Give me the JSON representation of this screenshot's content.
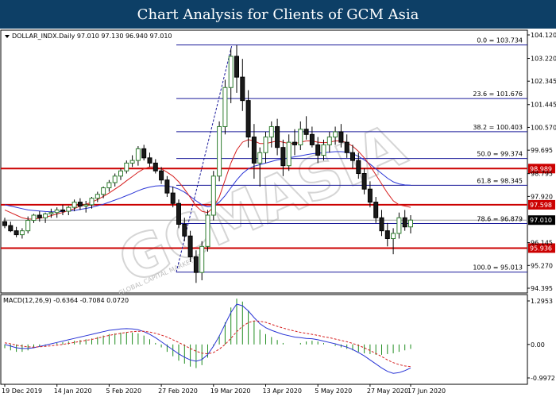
{
  "banner_title": "Chart Analysis for Clients of GCM Asia",
  "chart_data": {
    "type": "candlestick",
    "symbol_info": "DOLLAR_INDX.Daily  97.010 97.130 96.940 97.010",
    "macd_info": "MACD(12,26,9) -0.6364 -0.7084 0.0720",
    "watermark": "GCMASIA",
    "watermark_small": "GLOBAL CAPITAL MARKETS",
    "price_axis": {
      "ylim": [
        94.395,
        104.12
      ],
      "ticks": [
        "104.120",
        "103.220",
        "102.345",
        "101.445",
        "100.570",
        "99.695",
        "98.795",
        "97.920",
        "96.145",
        "95.270",
        "94.395"
      ]
    },
    "macd_axis": {
      "ylim": [
        -0.9972,
        1.2953
      ],
      "ticks": [
        "1.2953",
        "0.00",
        "-0.9972"
      ]
    },
    "x_ticks": [
      "19 Dec 2019",
      "14 Jan 2020",
      "5 Feb 2020",
      "27 Feb 2020",
      "19 Mar 2020",
      "13 Apr 2020",
      "5 May 2020",
      "27 May 2020",
      "17 Jun 2020"
    ],
    "fibonacci": [
      {
        "label": "0.0 = 103.734",
        "price": 103.734
      },
      {
        "label": "23.6 = 101.676",
        "price": 101.676
      },
      {
        "label": "38.2 = 100.403",
        "price": 100.403
      },
      {
        "label": "50.0 = 99.374",
        "price": 99.374
      },
      {
        "label": "61.8 = 98.345",
        "price": 98.345
      },
      {
        "label": "78.6 = 96.879",
        "price": 96.879
      },
      {
        "label": "100.0 = 95.013",
        "price": 95.013
      }
    ],
    "levels": [
      {
        "label": "98.989",
        "price": 98.989,
        "color": "#cc0000"
      },
      {
        "label": "97.598",
        "price": 97.598,
        "color": "#cc0000"
      },
      {
        "label": "95.936",
        "price": 95.936,
        "color": "#cc0000"
      }
    ],
    "current_price": {
      "label": "97.010",
      "price": 97.01
    },
    "candles": [
      [
        96.95,
        97.1,
        96.7,
        96.8
      ],
      [
        96.8,
        96.95,
        96.55,
        96.6
      ],
      [
        96.6,
        96.75,
        96.35,
        96.45
      ],
      [
        96.45,
        96.7,
        96.3,
        96.6
      ],
      [
        96.6,
        97.15,
        96.5,
        97.0
      ],
      [
        97.0,
        97.25,
        96.9,
        97.2
      ],
      [
        97.2,
        97.35,
        96.95,
        97.1
      ],
      [
        97.1,
        97.3,
        96.9,
        97.25
      ],
      [
        97.25,
        97.45,
        97.1,
        97.3
      ],
      [
        97.3,
        97.5,
        97.1,
        97.4
      ],
      [
        97.4,
        97.6,
        97.2,
        97.35
      ],
      [
        97.35,
        97.55,
        97.2,
        97.5
      ],
      [
        97.5,
        97.8,
        97.35,
        97.7
      ],
      [
        97.7,
        97.85,
        97.4,
        97.55
      ],
      [
        97.55,
        97.75,
        97.3,
        97.6
      ],
      [
        97.6,
        97.9,
        97.45,
        97.85
      ],
      [
        97.85,
        98.1,
        97.7,
        98.0
      ],
      [
        98.0,
        98.3,
        97.85,
        98.25
      ],
      [
        98.25,
        98.55,
        98.1,
        98.45
      ],
      [
        98.45,
        98.8,
        98.3,
        98.7
      ],
      [
        98.7,
        99.0,
        98.55,
        98.9
      ],
      [
        98.9,
        99.3,
        98.8,
        99.2
      ],
      [
        99.2,
        99.5,
        99.05,
        99.3
      ],
      [
        99.3,
        99.85,
        99.1,
        99.75
      ],
      [
        99.75,
        99.9,
        99.3,
        99.4
      ],
      [
        99.4,
        99.6,
        99.05,
        99.2
      ],
      [
        99.2,
        99.35,
        98.8,
        98.9
      ],
      [
        98.9,
        99.05,
        98.4,
        98.55
      ],
      [
        98.55,
        98.7,
        97.9,
        98.05
      ],
      [
        98.05,
        98.3,
        97.5,
        97.65
      ],
      [
        97.65,
        97.8,
        96.7,
        96.85
      ],
      [
        96.85,
        97.1,
        96.2,
        96.4
      ],
      [
        96.4,
        96.6,
        95.4,
        95.6
      ],
      [
        95.6,
        95.85,
        94.6,
        95.0
      ],
      [
        95.0,
        96.2,
        94.7,
        96.0
      ],
      [
        96.0,
        97.4,
        95.8,
        97.2
      ],
      [
        97.2,
        98.9,
        97.0,
        98.7
      ],
      [
        98.7,
        100.8,
        98.5,
        100.6
      ],
      [
        100.6,
        102.4,
        100.3,
        102.1
      ],
      [
        102.1,
        103.6,
        101.5,
        103.3
      ],
      [
        103.3,
        103.73,
        101.9,
        102.5
      ],
      [
        102.5,
        103.2,
        101.2,
        101.6
      ],
      [
        101.6,
        102.0,
        99.8,
        100.2
      ],
      [
        100.2,
        100.7,
        98.6,
        99.2
      ],
      [
        99.2,
        99.8,
        98.3,
        99.6
      ],
      [
        99.6,
        100.4,
        99.2,
        100.2
      ],
      [
        100.2,
        100.8,
        99.8,
        100.6
      ],
      [
        100.6,
        100.9,
        99.5,
        99.8
      ],
      [
        99.8,
        100.1,
        98.7,
        99.1
      ],
      [
        99.1,
        100.3,
        98.9,
        100.0
      ],
      [
        100.0,
        100.5,
        99.5,
        99.9
      ],
      [
        99.9,
        100.8,
        99.7,
        100.5
      ],
      [
        100.5,
        101.0,
        100.1,
        100.3
      ],
      [
        100.3,
        100.6,
        99.8,
        99.9
      ],
      [
        99.9,
        100.2,
        99.2,
        99.5
      ],
      [
        99.5,
        100.1,
        99.3,
        99.9
      ],
      [
        99.9,
        100.4,
        99.6,
        100.2
      ],
      [
        100.2,
        100.6,
        99.9,
        100.4
      ],
      [
        100.4,
        100.7,
        99.8,
        100.0
      ],
      [
        100.0,
        100.3,
        99.4,
        99.6
      ],
      [
        99.6,
        99.9,
        99.0,
        99.3
      ],
      [
        99.3,
        99.6,
        98.6,
        98.8
      ],
      [
        98.8,
        99.0,
        98.0,
        98.2
      ],
      [
        98.2,
        98.5,
        97.5,
        97.7
      ],
      [
        97.7,
        97.9,
        96.9,
        97.1
      ],
      [
        97.1,
        97.4,
        96.4,
        96.6
      ],
      [
        96.6,
        96.9,
        96.0,
        96.3
      ],
      [
        96.3,
        96.7,
        95.7,
        96.5
      ],
      [
        96.5,
        97.3,
        96.3,
        97.1
      ],
      [
        97.1,
        97.4,
        96.6,
        96.75
      ],
      [
        96.75,
        97.2,
        96.5,
        97.01
      ]
    ],
    "ma_red": [
      97.4,
      97.3,
      97.2,
      97.1,
      97.05,
      97.05,
      97.08,
      97.12,
      97.18,
      97.25,
      97.3,
      97.38,
      97.45,
      97.55,
      97.62,
      97.7,
      97.8,
      97.92,
      98.05,
      98.2,
      98.35,
      98.52,
      98.68,
      98.85,
      98.98,
      99.05,
      99.05,
      98.98,
      98.85,
      98.7,
      98.48,
      98.2,
      97.88,
      97.55,
      97.35,
      97.3,
      97.5,
      97.9,
      98.55,
      99.2,
      99.7,
      100.0,
      100.1,
      100.05,
      99.95,
      99.95,
      100.0,
      100.05,
      100.0,
      99.95,
      99.95,
      100.0,
      100.05,
      100.05,
      100.0,
      99.98,
      100.0,
      100.05,
      100.05,
      99.98,
      99.85,
      99.65,
      99.4,
      99.1,
      98.75,
      98.4,
      98.05,
      97.75,
      97.6,
      97.55,
      97.5
    ],
    "ma_blue": [
      97.6,
      97.55,
      97.5,
      97.45,
      97.4,
      97.38,
      97.36,
      97.34,
      97.33,
      97.33,
      97.34,
      97.36,
      97.38,
      97.42,
      97.46,
      97.5,
      97.56,
      97.62,
      97.7,
      97.78,
      97.86,
      97.95,
      98.04,
      98.14,
      98.22,
      98.28,
      98.32,
      98.33,
      98.32,
      98.28,
      98.2,
      98.08,
      97.92,
      97.75,
      97.6,
      97.52,
      97.55,
      97.7,
      97.95,
      98.25,
      98.55,
      98.8,
      98.98,
      99.08,
      99.14,
      99.2,
      99.26,
      99.32,
      99.36,
      99.4,
      99.44,
      99.48,
      99.52,
      99.56,
      99.58,
      99.6,
      99.62,
      99.64,
      99.64,
      99.62,
      99.56,
      99.46,
      99.32,
      99.16,
      98.98,
      98.8,
      98.62,
      98.48,
      98.4,
      98.36,
      98.35
    ],
    "macd_hist": [
      -0.05,
      -0.08,
      -0.1,
      -0.1,
      -0.08,
      -0.05,
      -0.03,
      -0.02,
      0.0,
      0.02,
      0.03,
      0.04,
      0.05,
      0.06,
      0.07,
      0.08,
      0.1,
      0.12,
      0.14,
      0.15,
      0.16,
      0.17,
      0.16,
      0.15,
      0.12,
      0.07,
      0.02,
      -0.04,
      -0.1,
      -0.16,
      -0.22,
      -0.26,
      -0.3,
      -0.32,
      -0.28,
      -0.18,
      -0.02,
      0.12,
      0.3,
      0.5,
      0.62,
      0.58,
      0.46,
      0.32,
      0.2,
      0.14,
      0.1,
      0.06,
      0.02,
      0.0,
      0.0,
      0.02,
      0.04,
      0.05,
      0.04,
      0.02,
      0.0,
      -0.02,
      -0.04,
      -0.06,
      -0.08,
      -0.1,
      -0.12,
      -0.13,
      -0.14,
      -0.14,
      -0.13,
      -0.12,
      -0.1,
      -0.08,
      -0.06
    ],
    "macd_line": [
      0.0,
      -0.05,
      -0.1,
      -0.12,
      -0.12,
      -0.1,
      -0.06,
      -0.02,
      0.02,
      0.06,
      0.1,
      0.14,
      0.18,
      0.22,
      0.26,
      0.3,
      0.34,
      0.38,
      0.42,
      0.44,
      0.46,
      0.47,
      0.46,
      0.44,
      0.38,
      0.3,
      0.2,
      0.08,
      -0.04,
      -0.16,
      -0.28,
      -0.38,
      -0.46,
      -0.5,
      -0.45,
      -0.3,
      -0.05,
      0.25,
      0.6,
      0.95,
      1.2,
      1.15,
      1.0,
      0.8,
      0.62,
      0.5,
      0.42,
      0.36,
      0.3,
      0.26,
      0.22,
      0.2,
      0.18,
      0.17,
      0.14,
      0.1,
      0.06,
      0.02,
      -0.03,
      -0.08,
      -0.15,
      -0.24,
      -0.34,
      -0.46,
      -0.58,
      -0.7,
      -0.8,
      -0.86,
      -0.84,
      -0.78,
      -0.7
    ],
    "signal_line": [
      0.05,
      0.02,
      -0.02,
      -0.05,
      -0.07,
      -0.08,
      -0.07,
      -0.06,
      -0.04,
      -0.02,
      0.0,
      0.03,
      0.06,
      0.09,
      0.12,
      0.15,
      0.19,
      0.23,
      0.27,
      0.3,
      0.33,
      0.36,
      0.38,
      0.39,
      0.39,
      0.37,
      0.33,
      0.28,
      0.22,
      0.14,
      0.06,
      -0.03,
      -0.12,
      -0.2,
      -0.26,
      -0.28,
      -0.24,
      -0.14,
      0.0,
      0.18,
      0.38,
      0.54,
      0.65,
      0.7,
      0.69,
      0.66,
      0.6,
      0.54,
      0.49,
      0.44,
      0.4,
      0.36,
      0.33,
      0.3,
      0.27,
      0.23,
      0.2,
      0.16,
      0.12,
      0.08,
      0.03,
      -0.03,
      -0.1,
      -0.18,
      -0.27,
      -0.36,
      -0.46,
      -0.54,
      -0.6,
      -0.64,
      -0.66
    ]
  }
}
